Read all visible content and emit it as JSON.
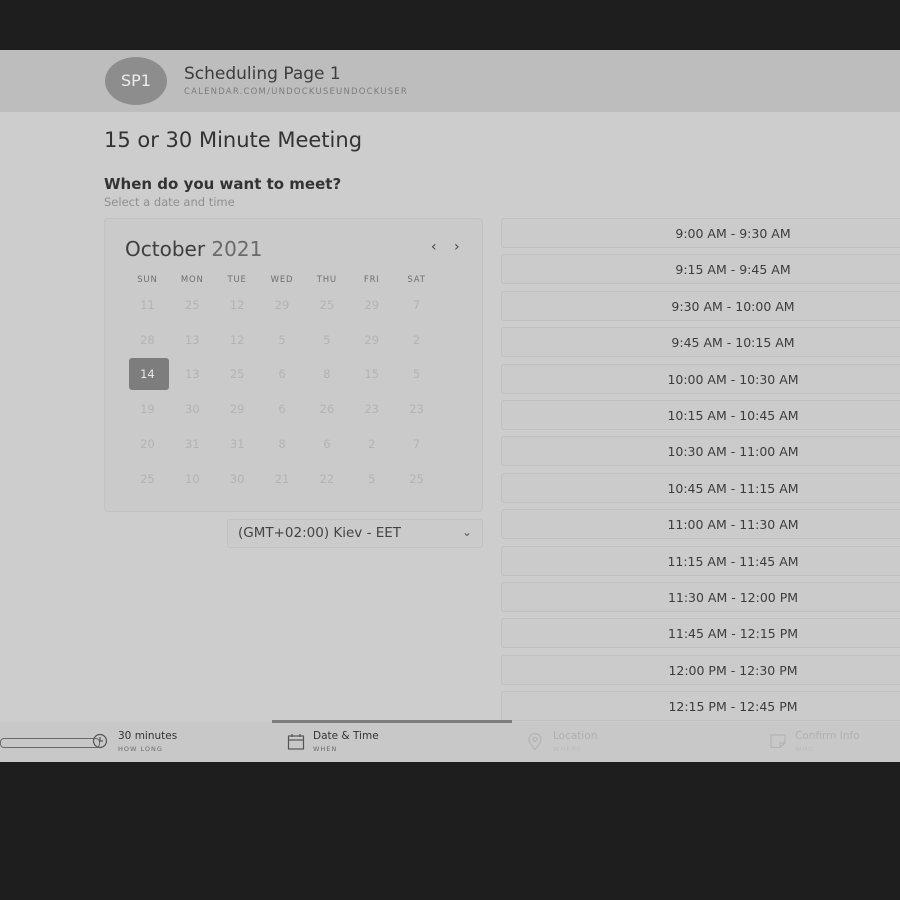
{
  "header": {
    "avatar_initials": "SP1",
    "title": "Scheduling Page 1",
    "url": "CALENDAR.COM/UNDOCKUSEUNDOCKUSER"
  },
  "main": {
    "page_title": "15 or 30 Minute Meeting",
    "section_title": "When do you want to meet?",
    "section_subtitle": "Select a date and time"
  },
  "calendar": {
    "month": "October",
    "year": "2021",
    "prev_icon": "chevron-left-icon",
    "next_icon": "chevron-right-icon",
    "weekdays": [
      "SUN",
      "MON",
      "TUE",
      "WED",
      "THU",
      "FRI",
      "SAT"
    ],
    "weeks": [
      [
        "11",
        "25",
        "12",
        "29",
        "25",
        "29",
        "7"
      ],
      [
        "28",
        "13",
        "12",
        "5",
        "5",
        "29",
        "2"
      ],
      [
        "14",
        "13",
        "25",
        "6",
        "8",
        "15",
        "5"
      ],
      [
        "19",
        "30",
        "29",
        "6",
        "26",
        "23",
        "23"
      ],
      [
        "20",
        "31",
        "31",
        "8",
        "6",
        "2",
        "7"
      ],
      [
        "25",
        "10",
        "30",
        "21",
        "22",
        "5",
        "25"
      ]
    ],
    "selected_day": "14"
  },
  "timezone": {
    "value": "(GMT+02:00) Kiev - EET",
    "icon": "chevron-down-icon"
  },
  "slots": [
    "9:00 AM - 9:30 AM",
    "9:15 AM - 9:45 AM",
    "9:30 AM - 10:00 AM",
    "9:45 AM - 10:15 AM",
    "10:00 AM - 10:30 AM",
    "10:15 AM - 10:45 AM",
    "10:30 AM - 11:00 AM",
    "10:45 AM - 11:15 AM",
    "11:00 AM - 11:30 AM",
    "11:15 AM - 11:45 AM",
    "11:30 AM - 12:00 PM",
    "11:45 AM - 12:15 PM",
    "12:00 PM - 12:30 PM",
    "12:15 PM - 12:45 PM"
  ],
  "steps": [
    {
      "title": "30 minutes",
      "subtitle": "HOW LONG",
      "icon": "clock-icon",
      "state": "done"
    },
    {
      "title": "Date & Time",
      "subtitle": "WHEN",
      "icon": "calendar-icon",
      "state": "active"
    },
    {
      "title": "Location",
      "subtitle": "WHERE",
      "icon": "location-pin-icon",
      "state": "upcoming"
    },
    {
      "title": "Confirm Info",
      "subtitle": "WHO",
      "icon": "form-icon",
      "state": "upcoming"
    }
  ]
}
